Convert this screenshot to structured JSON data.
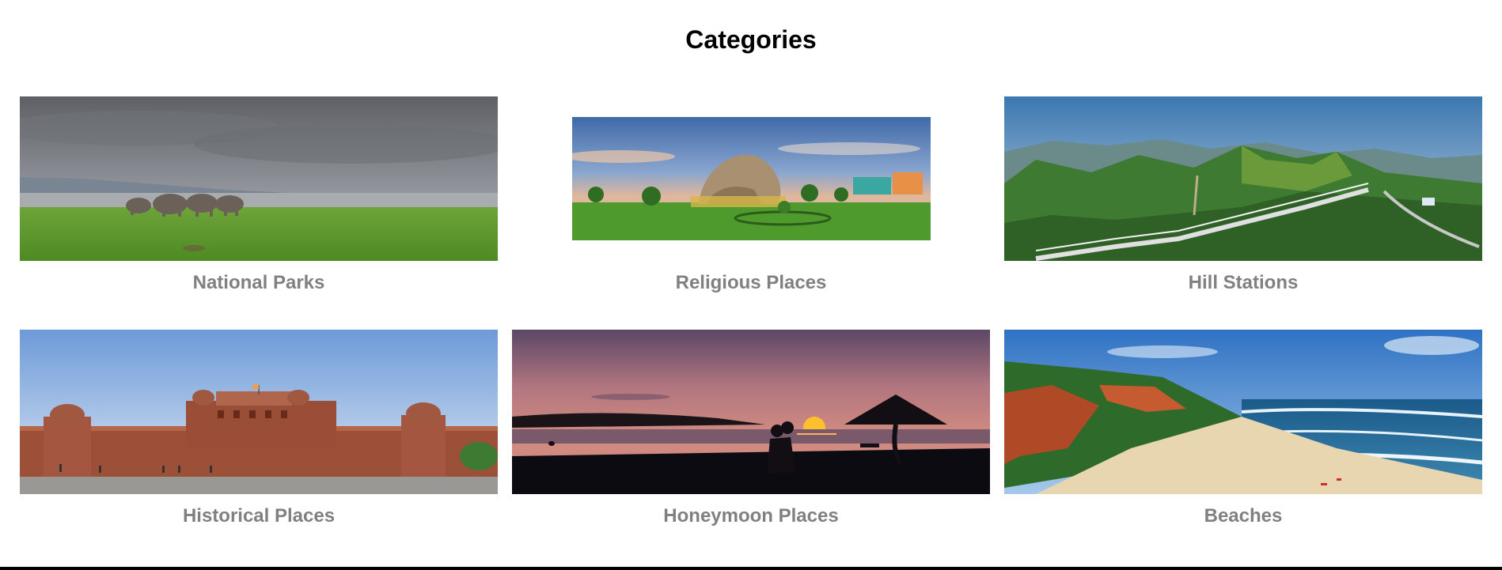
{
  "page": {
    "title": "Categories"
  },
  "categories": [
    {
      "label": "National Parks",
      "image": "elephants-grassland-image"
    },
    {
      "label": "Religious Places",
      "image": "statue-garden-image"
    },
    {
      "label": "Hill Stations",
      "image": "mountain-view-image"
    },
    {
      "label": "Historical Places",
      "image": "red-fort-image"
    },
    {
      "label": "Honeymoon Places",
      "image": "sunset-couple-beach-image"
    },
    {
      "label": "Beaches",
      "image": "cliff-beach-image"
    }
  ],
  "colors": {
    "title": "#000000",
    "label": "#808080",
    "rule": "#000000"
  }
}
